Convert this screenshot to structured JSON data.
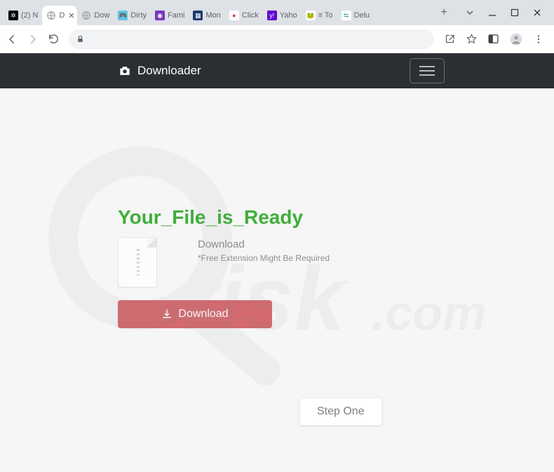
{
  "tabs": [
    {
      "label": "(2) N",
      "favicon_bg": "#000",
      "favicon_glyph": "✲",
      "glyph_color": "#fff"
    },
    {
      "label": "D",
      "favicon_bg": "#888",
      "favicon_glyph": "",
      "glyph_color": "#fff",
      "active": true
    },
    {
      "label": "Dow",
      "favicon_bg": "#888",
      "favicon_glyph": "",
      "glyph_color": "#fff"
    },
    {
      "label": "Dirty",
      "favicon_bg": "#62c4e6",
      "favicon_glyph": "🎮",
      "glyph_color": "#fff"
    },
    {
      "label": "Fami",
      "favicon_bg": "#7a36b5",
      "favicon_glyph": "◉",
      "glyph_color": "#fff"
    },
    {
      "label": "Mon",
      "favicon_bg": "#1b3a6b",
      "favicon_glyph": "▦",
      "glyph_color": "#fff"
    },
    {
      "label": "Click",
      "favicon_bg": "#fff",
      "favicon_glyph": "●",
      "glyph_color": "#d63b3b"
    },
    {
      "label": "Yaho",
      "favicon_bg": "#5f01d1",
      "favicon_glyph": "y!",
      "glyph_color": "#fff"
    },
    {
      "label": "≡ To",
      "favicon_bg": "#fff",
      "favicon_glyph": "🐸",
      "glyph_color": "#3a9"
    },
    {
      "label": "Delu",
      "favicon_bg": "#fff",
      "favicon_glyph": "⇆",
      "glyph_color": "#4aa"
    }
  ],
  "site": {
    "brand": "Downloader"
  },
  "content": {
    "heading": "Your_File_is_Ready",
    "subhead": "Download",
    "note": "*Free Extension Might Be Required",
    "button": "Download",
    "step": "Step One"
  },
  "watermark": "pcrisk.com"
}
